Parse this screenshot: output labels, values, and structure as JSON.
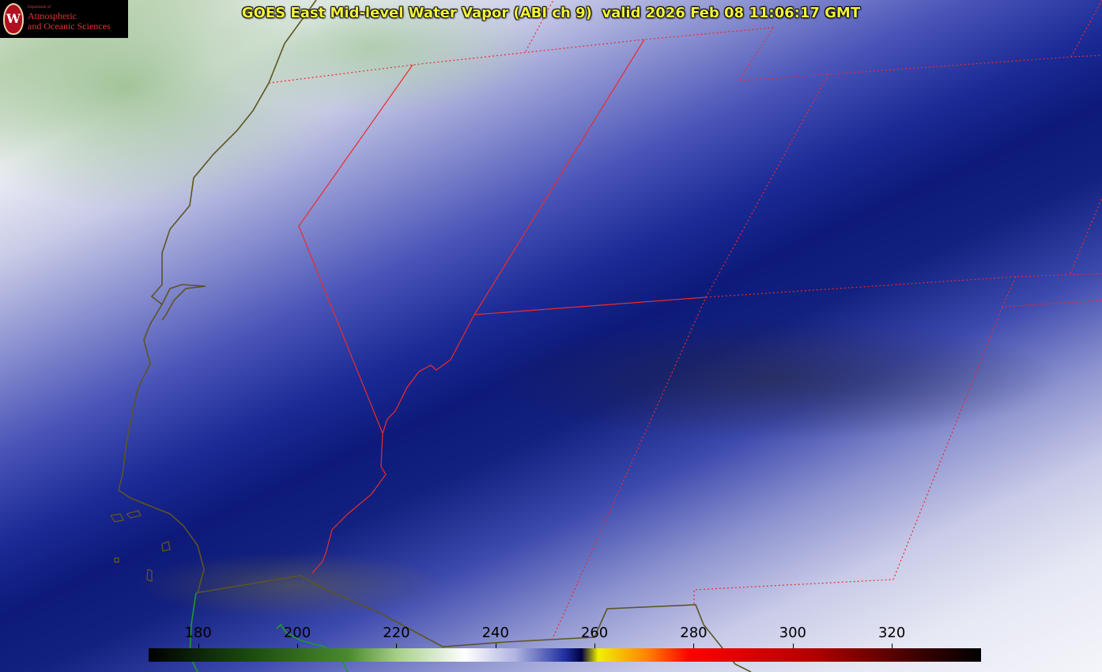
{
  "title": "GOES East Mid-level Water Vapor (ABI ch 9)  valid 2026 Feb 08 11:06:17 GMT",
  "logo": {
    "small_text": "Department of",
    "line1": "Atmospheric",
    "line2": "and Oceanic Sciences",
    "badge_letter": "W"
  },
  "colorbar": {
    "ticks": [
      "180",
      "200",
      "220",
      "240",
      "260",
      "280",
      "300",
      "320"
    ],
    "min": 170,
    "max": 338
  },
  "colors": {
    "title": "#f4f43a",
    "state_boundary": "#ee2a2a",
    "coastline": "#5e5420",
    "green_border": "#1f9a2a"
  }
}
